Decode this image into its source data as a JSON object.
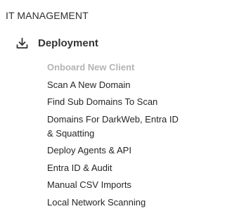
{
  "section": {
    "title": "IT MANAGEMENT"
  },
  "group": {
    "icon": "download-icon",
    "label": "Deployment"
  },
  "items": [
    {
      "label": "Onboard New Client",
      "disabled": true
    },
    {
      "label": "Scan A New Domain",
      "disabled": false
    },
    {
      "label": "Find Sub Domains To Scan",
      "disabled": false
    },
    {
      "label": "Domains For DarkWeb, Entra ID & Squatting",
      "disabled": false
    },
    {
      "label": "Deploy Agents & API",
      "disabled": false
    },
    {
      "label": "Entra ID & Audit",
      "disabled": false
    },
    {
      "label": "Manual CSV Imports",
      "disabled": false
    },
    {
      "label": "Local Network Scanning",
      "disabled": false
    }
  ],
  "colors": {
    "text": "#262626",
    "disabled_text": "#b4b4b4",
    "icon": "#333333"
  }
}
